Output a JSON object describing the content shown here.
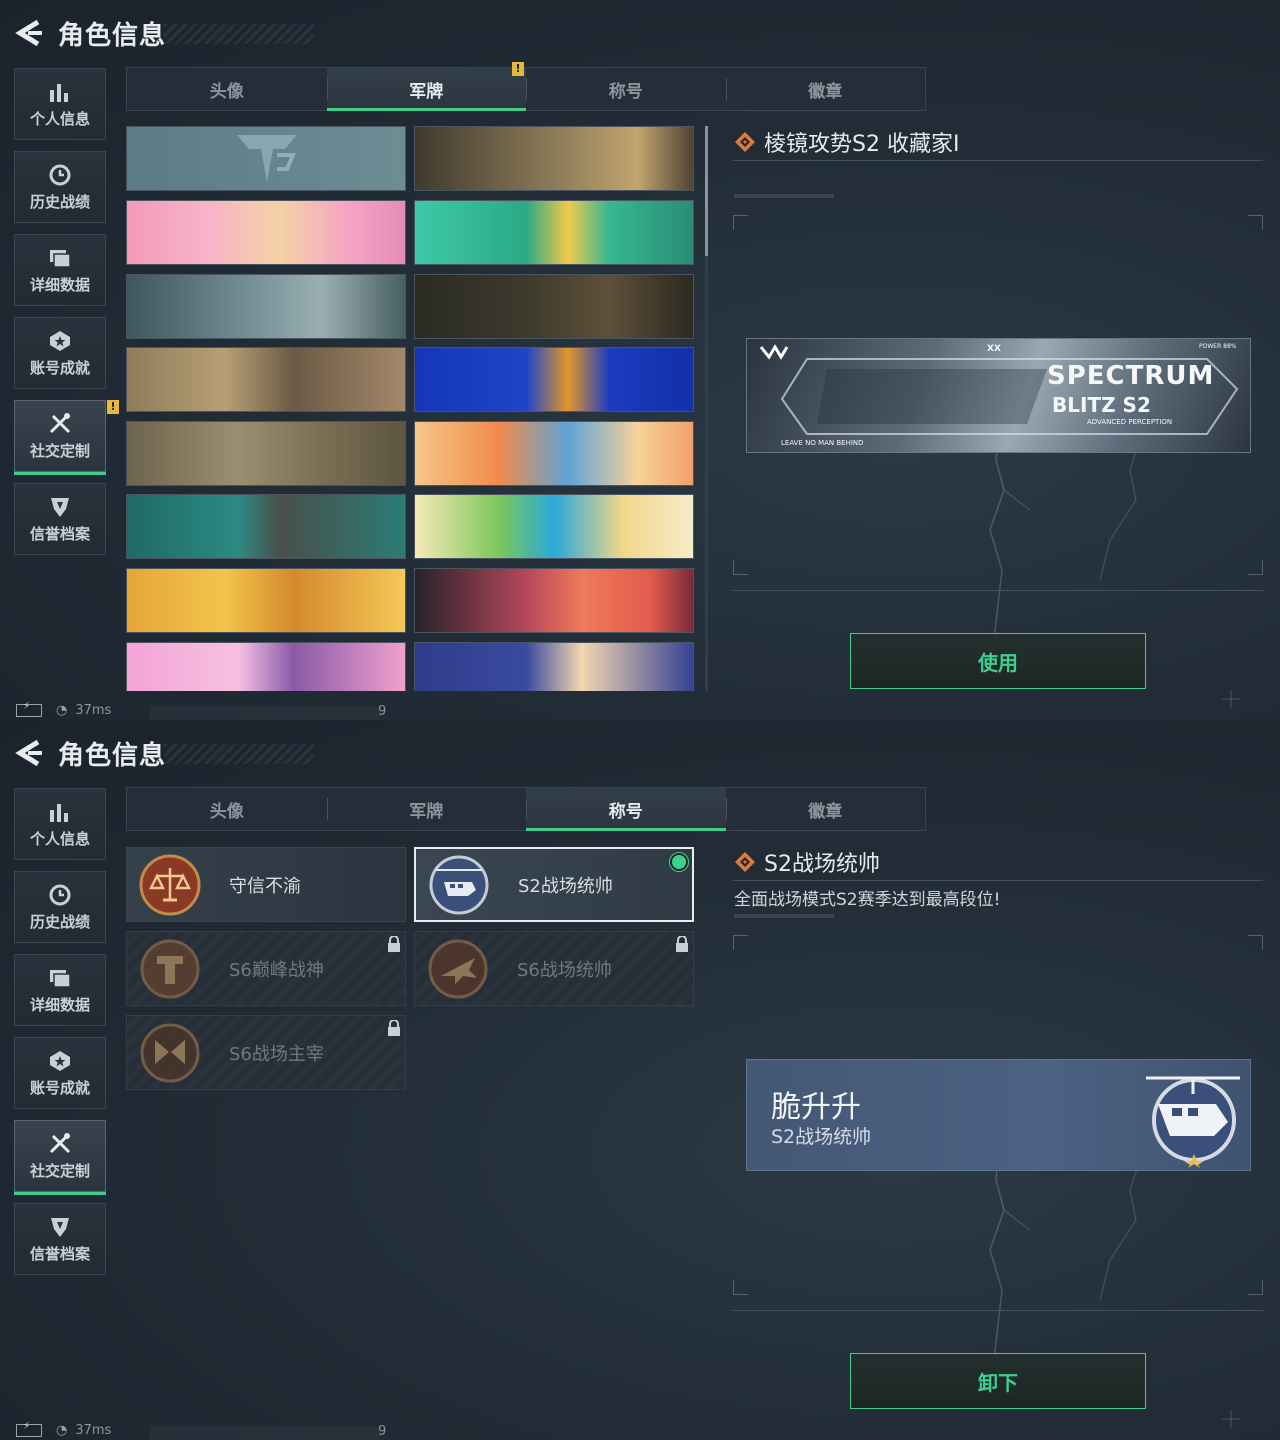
{
  "screen1": {
    "header": {
      "title": "角色信息"
    },
    "sidebar": [
      {
        "label": "个人信息"
      },
      {
        "label": "历史战绩"
      },
      {
        "label": "详细数据"
      },
      {
        "label": "账号成就"
      },
      {
        "label": "社交定制",
        "badge": "!"
      },
      {
        "label": "信誉档案"
      }
    ],
    "tabs": [
      {
        "label": "头像"
      },
      {
        "label": "军牌",
        "badge": "!"
      },
      {
        "label": "称号"
      },
      {
        "label": "徽章"
      }
    ],
    "detail": {
      "title": "棱镜攻势S2 收藏家I",
      "banner_text": {
        "main": "SPECTRUM",
        "sub": "BLITZ S2",
        "left_note": "LEAVE NO MAN BEHIND",
        "right_note": "ADVANCED PERCEPTION",
        "power": "POWER 88%",
        "xx": "XX"
      },
      "action_label": "使用"
    },
    "status": {
      "ping": "37ms",
      "num": "9"
    }
  },
  "screen2": {
    "header": {
      "title": "角色信息"
    },
    "sidebar": [
      {
        "label": "个人信息"
      },
      {
        "label": "历史战绩"
      },
      {
        "label": "详细数据"
      },
      {
        "label": "账号成就"
      },
      {
        "label": "社交定制"
      },
      {
        "label": "信誉档案"
      }
    ],
    "tabs": [
      {
        "label": "头像"
      },
      {
        "label": "军牌"
      },
      {
        "label": "称号"
      },
      {
        "label": "徽章"
      }
    ],
    "titles": [
      {
        "name": "守信不渝",
        "state": "unlocked"
      },
      {
        "name": "S2战场统帅",
        "state": "selected"
      },
      {
        "name": "S6巅峰战神",
        "state": "locked"
      },
      {
        "name": "S6战场统帅",
        "state": "locked"
      },
      {
        "name": "S6战场主宰",
        "state": "locked"
      }
    ],
    "detail": {
      "title": "S2战场统帅",
      "description": "全面战场模式S2赛季达到最高段位!",
      "plate_player": "脆升升",
      "plate_title": "S2战场统帅",
      "action_label": "卸下"
    },
    "status": {
      "ping": "37ms",
      "num": "9"
    }
  },
  "colors": {
    "accent": "#3ecf8e",
    "badge": "#e7b83a",
    "background": "#1d2630"
  }
}
